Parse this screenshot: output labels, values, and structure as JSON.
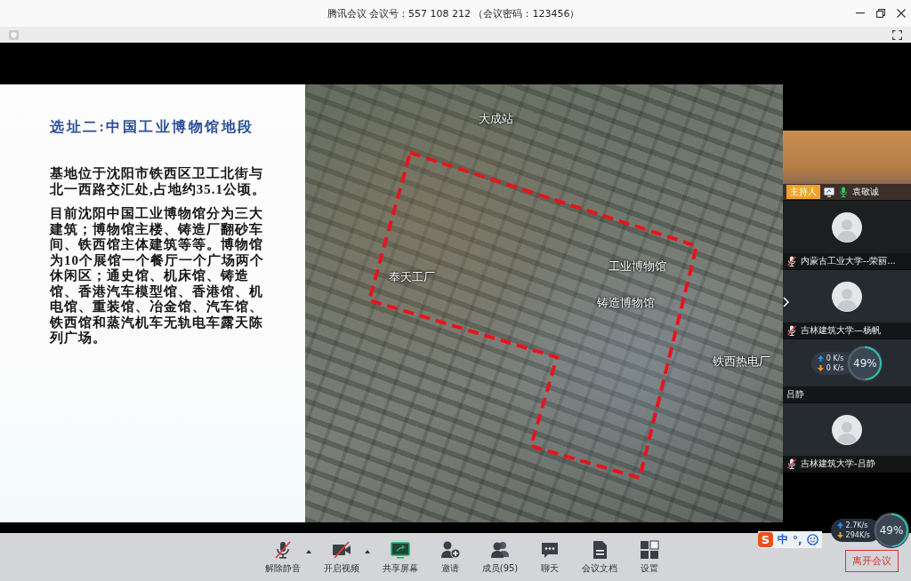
{
  "window": {
    "title": "腾讯会议 会议号：557 108 212 （会议密码：123456）"
  },
  "slide": {
    "heading": "选址二:中国工业博物馆地段",
    "paragraphs": [
      "基地位于沈阳市铁西区卫工北街与北一西路交汇处,占地约35.1公顷。",
      "目前沈阳中国工业博物馆分为三大建筑；博物馆主楼、铸造厂翻砂车间、铁西馆主体建筑等等。博物馆为10个展馆一个餐厅一个广场两个休闲区；通史馆、机床馆、铸造馆、香港汽车模型馆、香港馆、机电馆、重装馆、冶金馆、汽车馆、铁西馆和蒸汽机车无轨电车露天陈列广场。"
    ],
    "map_labels": [
      "大成站",
      "工业博物馆",
      "奉天工厂",
      "铸造博物馆",
      "铁西热电厂"
    ]
  },
  "participants": [
    {
      "kind": "video",
      "badge": "主持人",
      "name": "袁敬诚",
      "sharing": true,
      "muted": false
    },
    {
      "kind": "avatar",
      "name": "内蒙古工业大学--荣丽...",
      "muted": true
    },
    {
      "kind": "avatar",
      "name": "吉林建筑大学—杨帆",
      "muted": true
    },
    {
      "kind": "covered",
      "name": "吕静"
    },
    {
      "kind": "avatar",
      "name": "吉林建筑大学-吕静",
      "muted": true
    }
  ],
  "panel_monitor": {
    "upload": "0 K/s",
    "download": "0 K/s",
    "load": "49%",
    "level": 0.49
  },
  "toolbar": {
    "buttons": [
      {
        "kind": "mic",
        "label": "解除静音",
        "off": true,
        "menu": true
      },
      {
        "kind": "camera",
        "label": "开启视频",
        "off": true,
        "menu": true
      },
      {
        "kind": "share",
        "label": "共享屏幕",
        "off": false,
        "menu": false
      },
      {
        "kind": "invite",
        "label": "邀请",
        "off": false,
        "menu": false
      },
      {
        "kind": "members",
        "label": "成员(95)",
        "off": false,
        "menu": false
      },
      {
        "kind": "chat",
        "label": "聊天",
        "off": false,
        "menu": false
      },
      {
        "kind": "document",
        "label": "会议文档",
        "off": false,
        "menu": false
      },
      {
        "kind": "settings",
        "label": "设置",
        "off": false,
        "menu": false
      }
    ],
    "leave": "离开会议"
  },
  "ime": {
    "logo": "S",
    "mode": "中",
    "punctuation": "°,"
  },
  "net_monitor": {
    "upload": "2.7K/s",
    "download": "294K/s",
    "load": "49%",
    "level": 0.49
  }
}
